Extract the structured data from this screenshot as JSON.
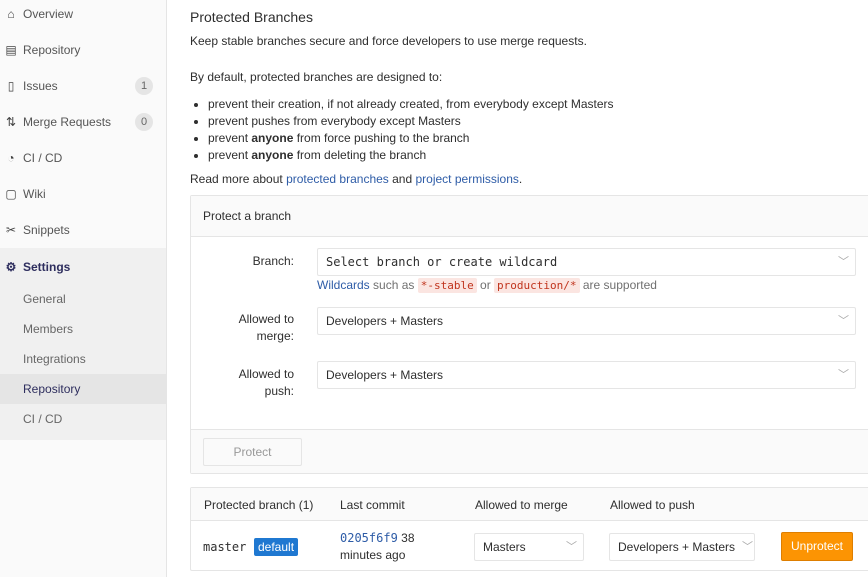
{
  "sidebar": {
    "items": [
      {
        "label": "Overview",
        "icon": "home-icon",
        "glyph": "⌂"
      },
      {
        "label": "Repository",
        "icon": "doc-icon",
        "glyph": "▤"
      },
      {
        "label": "Issues",
        "icon": "issues-icon",
        "glyph": "▯",
        "count": "1"
      },
      {
        "label": "Merge Requests",
        "icon": "merge-icon",
        "glyph": "⇅",
        "count": "0"
      },
      {
        "label": "CI / CD",
        "icon": "pipeline-icon",
        "glyph": "◔"
      },
      {
        "label": "Wiki",
        "icon": "book-icon",
        "glyph": "▢"
      },
      {
        "label": "Snippets",
        "icon": "scissors-icon",
        "glyph": "✂"
      },
      {
        "label": "Settings",
        "icon": "gear-icon",
        "glyph": "⚙"
      }
    ],
    "sub": [
      "General",
      "Members",
      "Integrations",
      "Repository",
      "CI / CD"
    ]
  },
  "page": {
    "title": "Protected Branches",
    "desc": "Keep stable branches secure and force developers to use merge requests.",
    "intro": "By default, protected branches are designed to:",
    "bullets": [
      {
        "pre": "prevent their creation, if not already created, from everybody except Masters",
        "bold": "",
        "post": ""
      },
      {
        "pre": "prevent pushes from everybody except Masters",
        "bold": "",
        "post": ""
      },
      {
        "pre": "prevent ",
        "bold": "anyone",
        "post": " from force pushing to the branch"
      },
      {
        "pre": "prevent ",
        "bold": "anyone",
        "post": " from deleting the branch"
      }
    ],
    "read_more": "Read more about ",
    "link1": "protected branches",
    "and": " and ",
    "link2": "project permissions",
    "dot": "."
  },
  "form": {
    "header": "Protect a branch",
    "branch_label": "Branch:",
    "branch_placeholder": "Select branch or create wildcard",
    "hint_link": "Wildcards",
    "hint_a": " such as ",
    "code1": "*-stable",
    "hint_or": " or ",
    "code2": "production/*",
    "hint_b": " are supported",
    "merge_label": "Allowed to merge:",
    "merge_value": "Developers + Masters",
    "push_label": "Allowed to push:",
    "push_value": "Developers + Masters",
    "protect": "Protect"
  },
  "table": {
    "headers": [
      "Protected branch (1)",
      "Last commit",
      "Allowed to merge",
      "Allowed to push"
    ],
    "row": {
      "branch": "master",
      "badge": "default",
      "commit": "0205f6f9",
      "time1": "38",
      "time2": "minutes ago",
      "merge": "Masters",
      "push": "Developers + Masters",
      "unprotect": "Unprotect"
    }
  },
  "colors": {
    "accent": "#2e5ca7",
    "badge": "#1f78d1",
    "unprotect": "#fc9403"
  }
}
